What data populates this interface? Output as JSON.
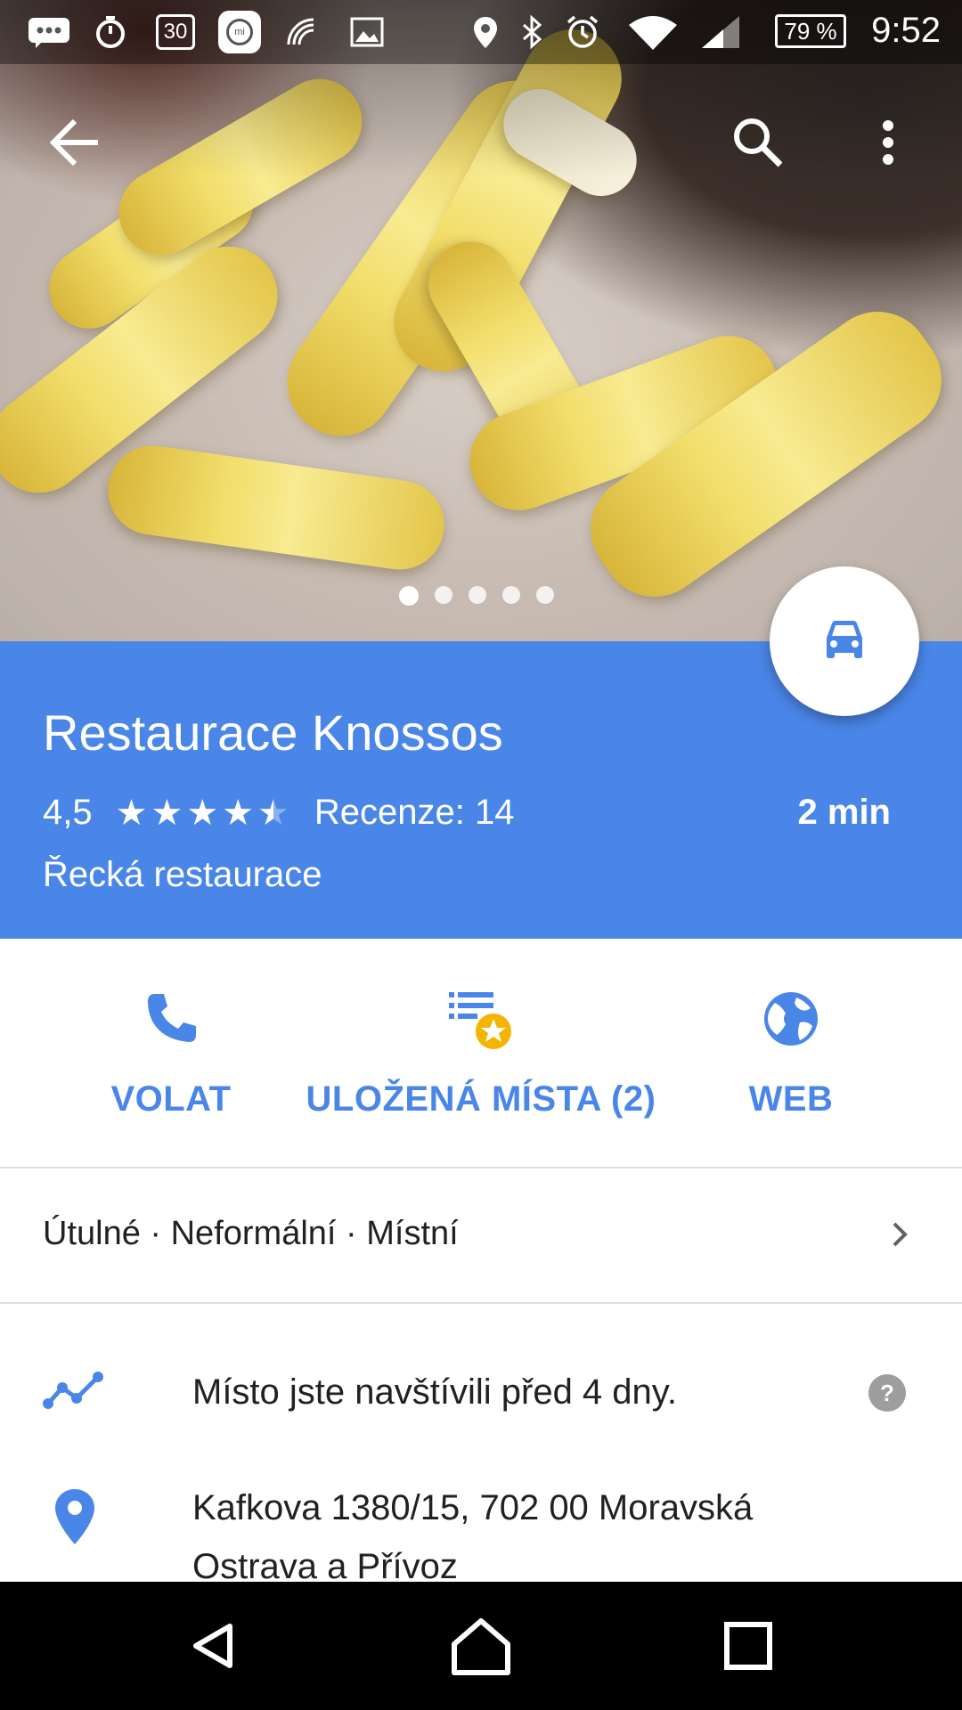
{
  "status_bar": {
    "time": "9:52",
    "battery": "79 %",
    "left_icons": [
      "messages-icon",
      "stopwatch-icon",
      "calendar-icon",
      "mi-icon",
      "nfc-icon",
      "image-icon"
    ],
    "right_icons": [
      "location-icon",
      "bluetooth-icon",
      "alarm-icon",
      "wifi-icon",
      "signal-icon",
      "battery-icon"
    ],
    "calendar_day": "30"
  },
  "hero": {
    "photo_count": 5,
    "active_index": 0
  },
  "place": {
    "name": "Restaurace Knossos",
    "rating": "4,5",
    "stars": 4.5,
    "reviews": "Recenze: 14",
    "category": "Řecká restaurace",
    "drive_time": "2 min"
  },
  "actions": [
    {
      "label": "VOLAT",
      "icon": "phone-icon"
    },
    {
      "label": "ULOŽENÁ MÍSTA (2)",
      "icon": "saved-list-star-icon"
    },
    {
      "label": "WEB",
      "icon": "globe-icon"
    }
  ],
  "tags": "Útulné · Neformální · Místní",
  "visited": "Místo jste navštívili před 4 dny.",
  "address": {
    "line1": "Kafkova 1380/15, 702 00 Moravská",
    "line2": "Ostrava a Přívoz"
  },
  "colors": {
    "accent": "#4a86e8",
    "star_badge": "#f4b400",
    "help_gray": "#9e9e9e"
  }
}
